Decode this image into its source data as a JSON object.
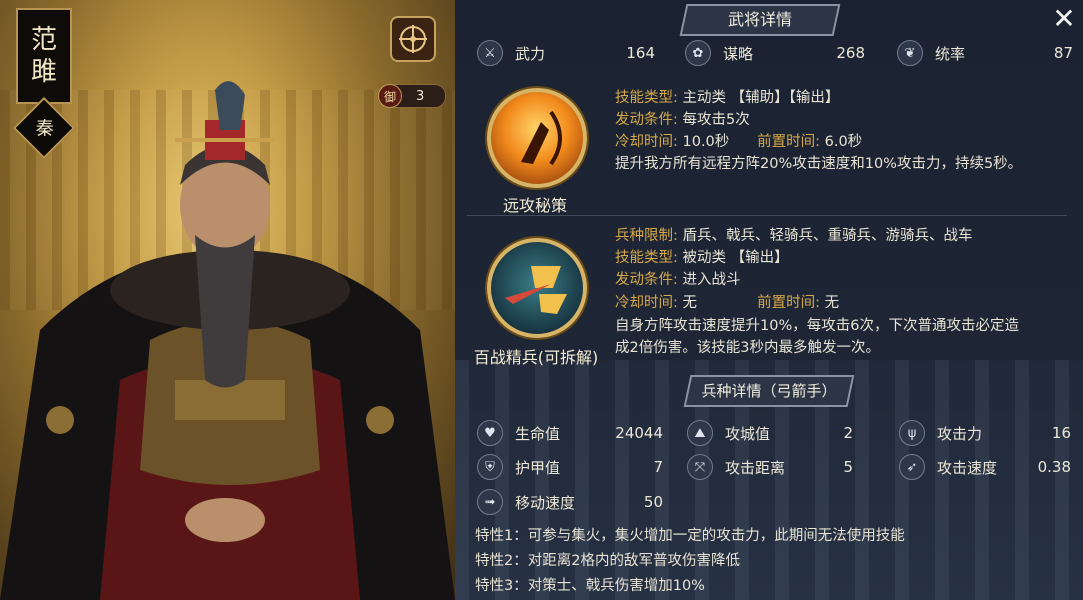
{
  "hero": {
    "name_char1": "范",
    "name_char2": "雎",
    "faction": "秦",
    "defense_badge": "御",
    "defense_value": "3"
  },
  "panel_title": "武将详情",
  "stats": [
    {
      "icon": "crossed-swords-icon",
      "label": "武力",
      "value": "164"
    },
    {
      "icon": "fan-icon",
      "label": "谋略",
      "value": "268"
    },
    {
      "icon": "bird-icon",
      "label": "统率",
      "value": "87"
    }
  ],
  "skill1": {
    "name": "远攻秘策",
    "type_k": "技能类型:",
    "type_v": "主动类 【辅助】【输出】",
    "cond_k": "发动条件:",
    "cond_v": "每攻击5次",
    "cd_k": "冷却时间:",
    "cd_v": "10.0秒",
    "pre_k": "前置时间:",
    "pre_v": "6.0秒",
    "desc": "提升我方所有远程方阵20%攻击速度和10%攻击力，持续5秒。"
  },
  "skill2": {
    "name": "百战精兵(可拆解)",
    "limit_k": "兵种限制:",
    "limit_v": "盾兵、戟兵、轻骑兵、重骑兵、游骑兵、战车",
    "type_k": "技能类型:",
    "type_v": "被动类 【输出】",
    "cond_k": "发动条件:",
    "cond_v": "进入战斗",
    "cd_k": "冷却时间:",
    "cd_v": "无",
    "pre_k": "前置时间:",
    "pre_v": "无",
    "desc1": "自身方阵攻击速度提升10%，每攻击6次，下次普通攻击必定造",
    "desc2": "成2倍伤害。该技能3秒内最多触发一次。"
  },
  "troop_title": "兵种详情（弓箭手）",
  "troop_stats": [
    {
      "icon": "heart-icon",
      "label": "生命值",
      "value": "24044"
    },
    {
      "icon": "siege-icon",
      "label": "攻城值",
      "value": "2"
    },
    {
      "icon": "trident-icon",
      "label": "攻击力",
      "value": "16"
    },
    {
      "icon": "shield-icon",
      "label": "护甲值",
      "value": "7"
    },
    {
      "icon": "range-icon",
      "label": "攻击距离",
      "value": "5"
    },
    {
      "icon": "speed-arrow-icon",
      "label": "攻击速度",
      "value": "0.38"
    },
    {
      "icon": "boot-icon",
      "label": "移动速度",
      "value": "50"
    }
  ],
  "traits": [
    "特性1：可参与集火，集火增加一定的攻击力，此期间无法使用技能",
    "特性2：对距离2格内的敌军普攻伤害降低",
    "特性3：对策士、戟兵伤害增加10%"
  ]
}
